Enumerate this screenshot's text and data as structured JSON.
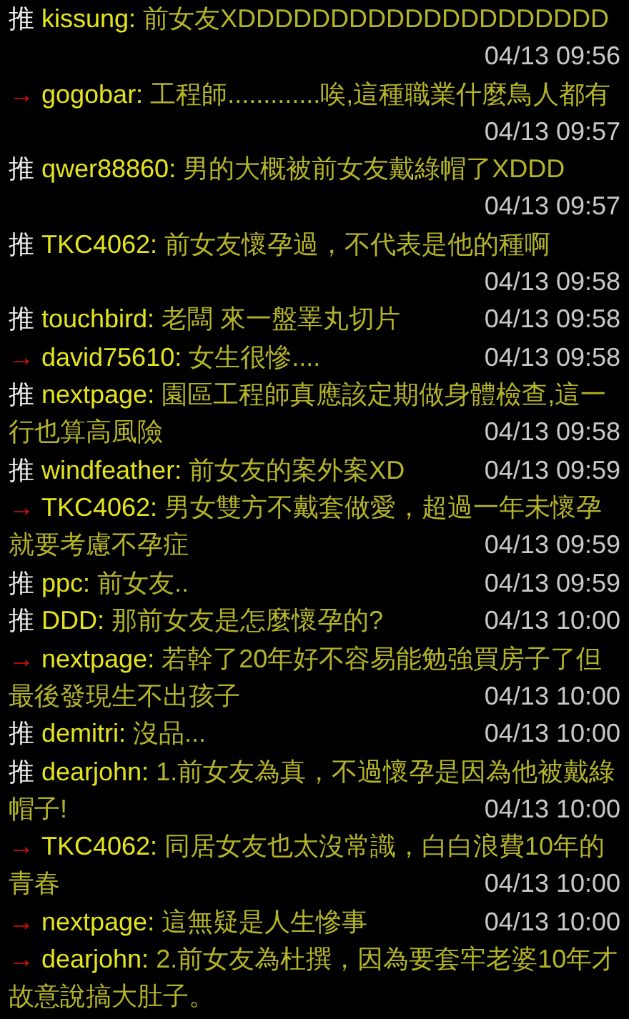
{
  "comments": [
    {
      "kind": "push",
      "tag": "推",
      "user": "kissung:",
      "text": "前女友XDDDDDDDDDDDDDDDDDDDD",
      "time": "04/13 09:56"
    },
    {
      "kind": "arrow",
      "tag": "→",
      "user": "gogobar:",
      "text": "工程師.............唉,這種職業什麼鳥人都有",
      "time": "04/13 09:57"
    },
    {
      "kind": "push",
      "tag": "推",
      "user": "qwer88860:",
      "text": "男的大概被前女友戴綠帽了XDDD",
      "time": "04/13 09:57"
    },
    {
      "kind": "push",
      "tag": "推",
      "user": "TKC4062:",
      "text": "前女友懷孕過，不代表是他的種啊",
      "time": "04/13 09:58"
    },
    {
      "kind": "push",
      "tag": "推",
      "user": "touchbird:",
      "text": "老闆 來一盤睪丸切片",
      "time": "04/13 09:58"
    },
    {
      "kind": "arrow",
      "tag": "→",
      "user": "david75610:",
      "text": "女生很慘....",
      "time": "04/13 09:58"
    },
    {
      "kind": "push",
      "tag": "推",
      "user": "nextpage:",
      "text": "園區工程師真應該定期做身體檢查,這一行也算高風險",
      "time": "04/13 09:58"
    },
    {
      "kind": "push",
      "tag": "推",
      "user": "windfeather:",
      "text": "前女友的案外案XD",
      "time": "04/13 09:59"
    },
    {
      "kind": "arrow",
      "tag": "→",
      "user": "TKC4062:",
      "text": "男女雙方不戴套做愛，超過一年未懷孕就要考慮不孕症",
      "time": "04/13 09:59"
    },
    {
      "kind": "push",
      "tag": "推",
      "user": "ppc:",
      "text": "前女友..",
      "time": "04/13 09:59"
    },
    {
      "kind": "push",
      "tag": "推",
      "user": "DDD:",
      "text": "那前女友是怎麼懷孕的?",
      "time": "04/13 10:00"
    },
    {
      "kind": "arrow",
      "tag": "→",
      "user": "nextpage:",
      "text": "若幹了20年好不容易能勉強買房子了但最後發現生不出孩子",
      "time": "04/13 10:00"
    },
    {
      "kind": "push",
      "tag": "推",
      "user": "demitri:",
      "text": "沒品...",
      "time": "04/13 10:00"
    },
    {
      "kind": "push",
      "tag": "推",
      "user": "dearjohn:",
      "text": "1.前女友為真，不過懷孕是因為他被戴綠帽子!",
      "time": "04/13 10:00"
    },
    {
      "kind": "arrow",
      "tag": "→",
      "user": "TKC4062:",
      "text": "同居女友也太沒常識，白白浪費10年的青春",
      "time": "04/13 10:00"
    },
    {
      "kind": "arrow",
      "tag": "→",
      "user": "nextpage:",
      "text": "這無疑是人生慘事",
      "time": "04/13 10:00"
    },
    {
      "kind": "arrow",
      "tag": "→",
      "user": "dearjohn:",
      "text": "2.前女友為杜撰，因為要套牢老婆10年才故意說搞大肚子。"
    }
  ]
}
